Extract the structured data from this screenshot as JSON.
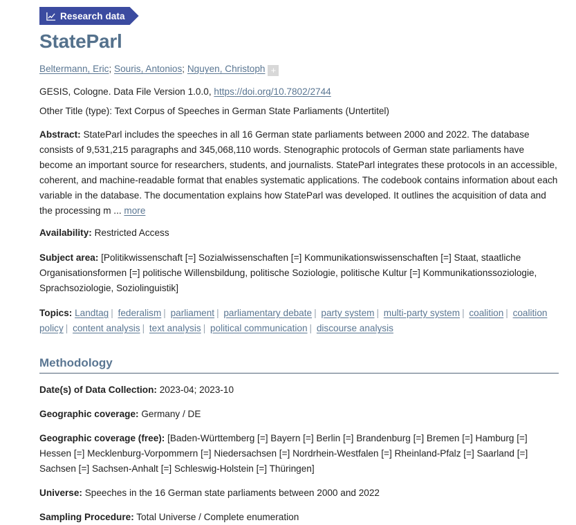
{
  "badge": {
    "label": "Research data",
    "icon": "line-chart-icon",
    "color": "#3b4ba0"
  },
  "title": "StateParl",
  "title_color": "#54718c",
  "link_color": "#5a7692",
  "authors": {
    "items": [
      "Beltermann, Eric",
      "Souris, Antonios",
      "Nguyen, Christoph"
    ],
    "separator": "; ",
    "more_authors_button": "+"
  },
  "citation": {
    "prefix": "GESIS, Cologne. Data File Version 1.0.0,",
    "doi_text": "https://doi.org/10.7802/2744"
  },
  "other_title": {
    "key": "Other Title (type):",
    "value": "Text Corpus of Speeches in German State Parliaments (Untertitel)"
  },
  "abstract": {
    "key": "Abstract:",
    "value": "StateParl includes the speeches in all 16 German state parliaments between 2000 and 2022. The database consists of 9,531,215 paragraphs and 345,068,110 words. Stenographic protocols of German state parliaments have become an important source for researchers, students, and journalists. StateParl integrates these protocols in an accessible, coherent, and machine-readable format that enables systematic applications. The codebook contains information about each variable in the database. The documentation explains how StateParl was developed. It outlines the acquisition of data and the processing m ...",
    "more_link": "more"
  },
  "availability": {
    "key": "Availability:",
    "value": "Restricted Access"
  },
  "subject_area": {
    "key": "Subject area:",
    "value": "[Politikwissenschaft [=] Sozialwissenschaften [=] Kommunikationswissenschaften [=] Staat, staatliche Organisationsformen [=] politische Willensbildung, politische Soziologie, politische Kultur [=] Kommunikationssoziologie, Sprachsoziologie, Soziolinguistik]"
  },
  "topics": {
    "key": "Topics:",
    "items": [
      "Landtag",
      "federalism",
      "parliament",
      "parliamentary debate",
      "party system",
      "multi-party system",
      "coalition",
      "coalition policy",
      "content analysis",
      "text analysis",
      "political communication",
      "discourse analysis"
    ],
    "separator": "|"
  },
  "methodology": {
    "heading": "Methodology",
    "fields": [
      {
        "key": "Date(s) of Data Collection:",
        "value": "2023-04; 2023-10"
      },
      {
        "key": "Geographic coverage:",
        "value": "Germany / DE"
      },
      {
        "key": "Geographic coverage (free):",
        "value": "[Baden-Württemberg [=] Bayern [=] Berlin [=] Brandenburg [=] Bremen [=] Hamburg [=] Hessen [=] Mecklenburg-Vorpommern [=] Niedersachsen [=] Nordrhein-Westfalen [=] Rheinland-Pfalz [=] Saarland [=] Sachsen [=] Sachsen-Anhalt [=] Schleswig-Holstein [=] Thüringen]"
      },
      {
        "key": "Universe:",
        "value": "Speeches in the 16 German state parliaments between 2000 and 2022"
      },
      {
        "key": "Sampling Procedure:",
        "value": "Total Universe / Complete enumeration"
      }
    ]
  }
}
